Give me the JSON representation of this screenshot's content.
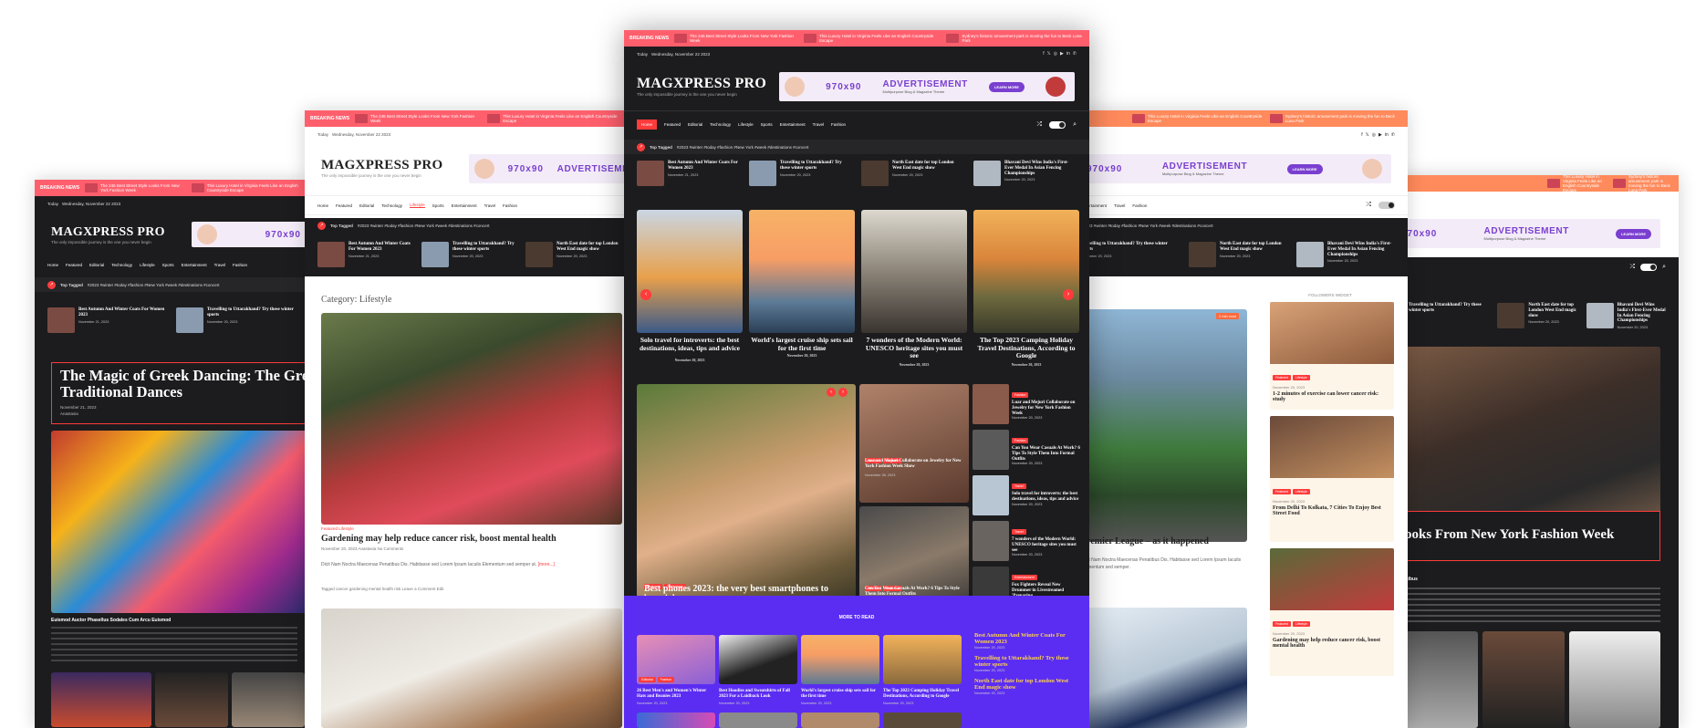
{
  "colors": {
    "accent": "#ff3b3b",
    "breaking": "#ff5f6d",
    "dark": "#1c1c1e",
    "purple": "#5b2df2",
    "ad": "#7a3fd0"
  },
  "breaking": {
    "label": "BREAKING NEWS",
    "items": [
      "The 245 Best Street Style Looks From New York Fashion Week",
      "This Luxury Hotel in Virginia Feels Like an English Countryside Escape",
      "Sydney's historic amusement park is moving the fun to Beck Luna Park"
    ]
  },
  "common": {
    "today": "Today",
    "date": "Wednesday, November 22 2023",
    "logo": "MAGXPRESS PRO",
    "tagline": "The only impossible journey is the one you never begin",
    "ad_size": "970x90",
    "ad_title": "ADVERTISEMENT",
    "ad_sub": "Multipurpose Blog & Magazine Theme",
    "ad_btn": "LEARN MORE",
    "top_tagged": "Top Tagged",
    "tags": "#2023  #winter  #today  #fashion  #New York  #week  #destinations  #concert"
  },
  "nav": [
    "Home",
    "Featured",
    "Editorial",
    "Technology",
    "Lifestyle",
    "Sports",
    "Entertainment",
    "Travel",
    "Fashion"
  ],
  "trending": [
    {
      "title": "Best Autumn And Winter Coats For Women 2023",
      "date": "November 21, 2023"
    },
    {
      "title": "Travelling to Uttarakhand? Try these winter sports",
      "date": "November 20, 2023"
    },
    {
      "title": "North East date for top London West End magic show",
      "date": "November 20, 2023"
    },
    {
      "title": "Bhavani Devi Wins India's First-Ever Medal In Asian Fencing Championships",
      "date": "November 20, 2023"
    }
  ],
  "left": {
    "headline": "The Magic of Greek Dancing: The Great Traditional Dances",
    "date": "November 21, 2023",
    "author": "Anastasia",
    "caption": "Euismod Auctor Phasellus Sodales Cum Arcu Euismod"
  },
  "lifestyle": {
    "category": "Category: Lifestyle",
    "read": "2 min read",
    "label": "Featured  Lifestyle",
    "headline": "Gardening may help reduce cancer risk, boost mental health",
    "meta": "November 20, 2023   Anastasia   No Comments",
    "excerpt": "Dicit Nam Noctra Maecenas Penatibus Dis. Habitasse sed Lorem Ipsum Iaculis Elementum sed semper ut.",
    "more": "[more...]",
    "tags": "Tagged cancer  gardening  mental health  risk   Leave a Comment   Edit"
  },
  "center": {
    "slides": [
      {
        "cap": "Solo travel for introverts: the best destinations, ideas, tips and advice",
        "date": "November 20, 2023"
      },
      {
        "cap": "World's largest cruise ship sets sail for the first time",
        "date": "November 20, 2023"
      },
      {
        "cap": "7 wonders of the Modern World: UNESCO heritage sites you must see",
        "date": "November 20, 2023"
      },
      {
        "cap": "The Top 2023 Camping Holiday Travel Destinations, According to Google",
        "date": "November 20, 2023"
      }
    ],
    "feature": {
      "cap": "Best phones 2023: the very best smartphones to buy right now",
      "date": "November 29, 2023"
    },
    "mid": [
      {
        "cap": "Luar and Mejuri Collaborate on Jewelry for New York Fashion Week Show",
        "date": "November 28, 2023"
      },
      {
        "cap": "Can You Wear Casuals At Work? 6 Tips To Style Them Into Formal Outfits",
        "date": "November 24, 2023"
      }
    ],
    "side": [
      {
        "title": "Luar and Mejuri Collaborate on Jewelry for New York Fashion Week",
        "date": "November 20, 2023"
      },
      {
        "title": "Can You Wear Casuals At Work? 6 Tips To Style Them Into Formal Outfits",
        "date": "November 20, 2023"
      },
      {
        "title": "Solo travel for introverts: the best destinations, ideas, tips and advice",
        "date": "November 20, 2023"
      },
      {
        "title": "7 wonders of the Modern World: UNESCO heritage sites you must see",
        "date": "November 20, 2023"
      },
      {
        "title": "Fox Fighters Reveal New Drummer in Livestreamed 'Preparing...",
        "date": "November 20, 2023"
      }
    ],
    "more_to_read": "MORE TO READ",
    "more": [
      {
        "cap": "26 Best Men's and Women's Winter Hats and Beanies 2023",
        "date": "November 20, 2023"
      },
      {
        "cap": "Best Hoodies and Sweatshirts of Fall 2023 For a Laidback Look",
        "date": "November 20, 2023"
      },
      {
        "cap": "World's largest cruise ship sets sail for the first time",
        "date": "November 20, 2023"
      },
      {
        "cap": "The Top 2023 Camping Holiday Travel Destinations, According to Google",
        "date": "November 20, 2023"
      }
    ],
    "more_side": [
      {
        "title": "Best Autumn And Winter Coats For Women 2023",
        "date": "November 20, 2023"
      },
      {
        "title": "Travelling to Uttarakhand? Try these winter sports",
        "date": "November 20, 2023"
      },
      {
        "title": "North East date for top London West End magic show",
        "date": "November 20, 2023"
      }
    ]
  },
  "right": {
    "read": "2 min read",
    "headline": "Premier League – as it happened",
    "widget": "FOLLOWERS WIDGET",
    "cards": [
      {
        "title": "1-2 minutes of exercise can lower cancer risk: study",
        "date": "November 20, 2023"
      },
      {
        "title": "From Delhi To Kolkata, 7 Cities To Enjoy Best Street Food",
        "date": "November 20, 2023"
      },
      {
        "title": "Gardening may help reduce cancer risk, boost mental health",
        "date": "November 20, 2023"
      }
    ],
    "excerpt": "Dicit Nam Noctra Maecenas Penatibus Dis. Habitasse sed Lorem Ipsum Iaculis Elementum sed semper."
  },
  "farright": {
    "headline": "ooks From New York Fashion Week",
    "author": "Penatibus",
    "tshirt": "DISPLACED"
  }
}
